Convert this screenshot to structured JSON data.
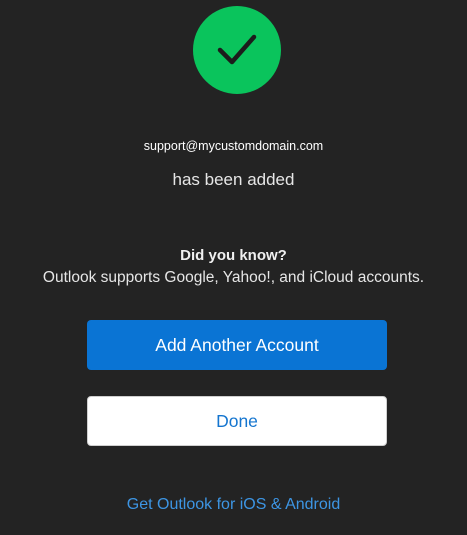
{
  "status": {
    "icon": "checkmark-icon",
    "icon_color": "#0ac45c"
  },
  "account": {
    "email": "support@mycustomdomain.com",
    "added_message": "has been added"
  },
  "tip": {
    "title": "Did you know?",
    "body": "Outlook supports Google, Yahoo!, and iCloud accounts."
  },
  "actions": {
    "add_another_label": "Add Another Account",
    "done_label": "Done",
    "mobile_link_label": "Get Outlook for iOS & Android"
  },
  "colors": {
    "background": "#232323",
    "primary": "#0a74d4",
    "link": "#3d95e3"
  }
}
